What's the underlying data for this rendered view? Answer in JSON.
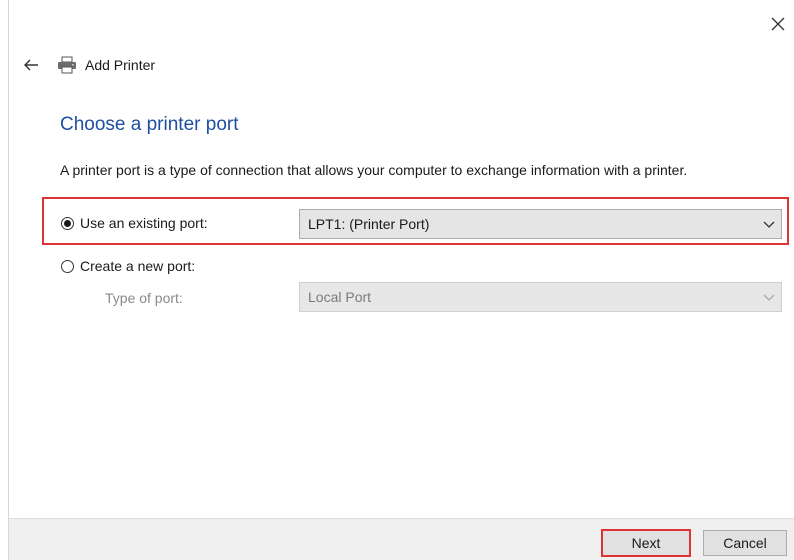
{
  "window": {
    "title": "Add Printer"
  },
  "page": {
    "heading": "Choose a printer port",
    "description": "A printer port is a type of connection that allows your computer to exchange information with a printer."
  },
  "options": {
    "existing": {
      "label": "Use an existing port:",
      "selected": true,
      "value": "LPT1: (Printer Port)"
    },
    "create": {
      "label": "Create a new port:",
      "selected": false,
      "type_label": "Type of port:",
      "value": "Local Port"
    }
  },
  "buttons": {
    "next": "Next",
    "cancel": "Cancel"
  },
  "colors": {
    "heading": "#1f4fa0",
    "highlight": "#e03232"
  },
  "icons": [
    "close-icon",
    "back-arrow-icon",
    "printer-icon",
    "chevron-down-icon",
    "radio-button-icon"
  ]
}
